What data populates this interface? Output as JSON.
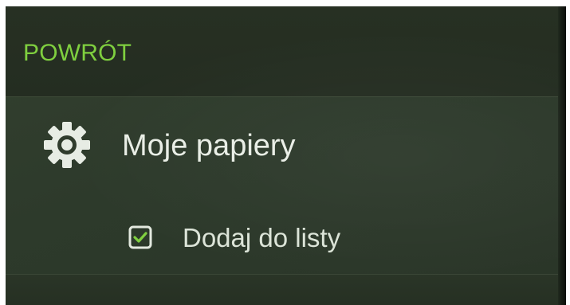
{
  "back": {
    "label": "POWRÓT"
  },
  "menu": {
    "items": [
      {
        "label": "Moje papiery",
        "icon": "gear-icon"
      },
      {
        "label": "Dodaj do listy",
        "icon": "checkbox-icon",
        "checked": true
      }
    ]
  },
  "colors": {
    "accent": "#7fcf3f",
    "background": "#2d3a2b",
    "text": "#e9eee6"
  }
}
